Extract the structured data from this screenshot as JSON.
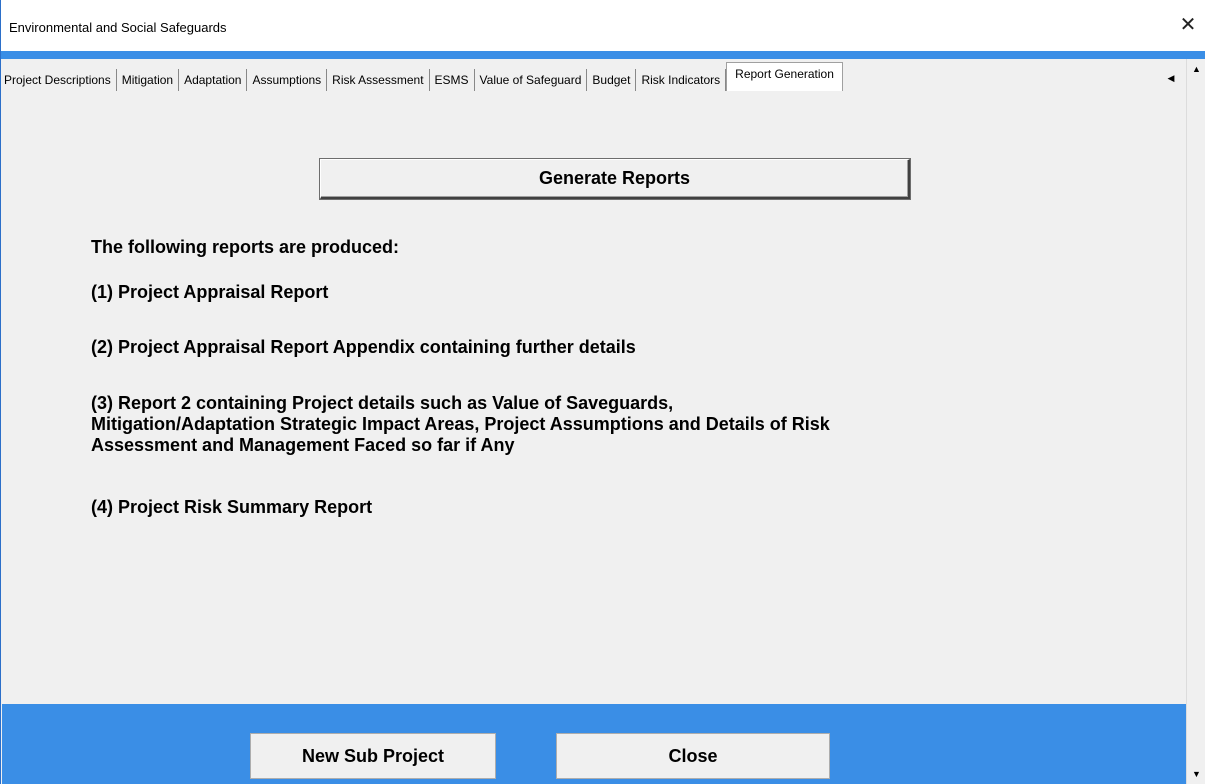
{
  "window": {
    "title": "Environmental and Social Safeguards",
    "close_glyph": "✕"
  },
  "tabs": [
    {
      "label": "Project Descriptions",
      "active": false
    },
    {
      "label": "Mitigation",
      "active": false
    },
    {
      "label": "Adaptation",
      "active": false
    },
    {
      "label": "Assumptions",
      "active": false
    },
    {
      "label": "Risk Assessment",
      "active": false
    },
    {
      "label": "ESMS",
      "active": false
    },
    {
      "label": "Value of Safeguard",
      "active": false
    },
    {
      "label": "Budget",
      "active": false
    },
    {
      "label": "Risk Indicators",
      "active": false
    },
    {
      "label": "Report Generation",
      "active": true
    }
  ],
  "tab_scroll": {
    "left_glyph": "◀"
  },
  "scrollbar": {
    "up_glyph": "▲",
    "down_glyph": "▼"
  },
  "main": {
    "generate_button_label": "Generate Reports",
    "intro": "The following reports are produced:",
    "reports": [
      "(1) Project Appraisal Report",
      "(2) Project Appraisal Report Appendix containing further details",
      "(3) Report 2 containing Project details such as Value of Saveguards,",
      "Mitigation/Adaptation Strategic Impact Areas, Project Assumptions and Details of Risk",
      "Assessment and Management Faced so far if Any",
      "(4) Project Risk Summary Report"
    ]
  },
  "footer": {
    "new_sub_project_label": "New Sub Project",
    "close_label": "Close"
  },
  "colors": {
    "accent_blue": "#3a8ee6",
    "panel_gray": "#f0f0f0"
  }
}
